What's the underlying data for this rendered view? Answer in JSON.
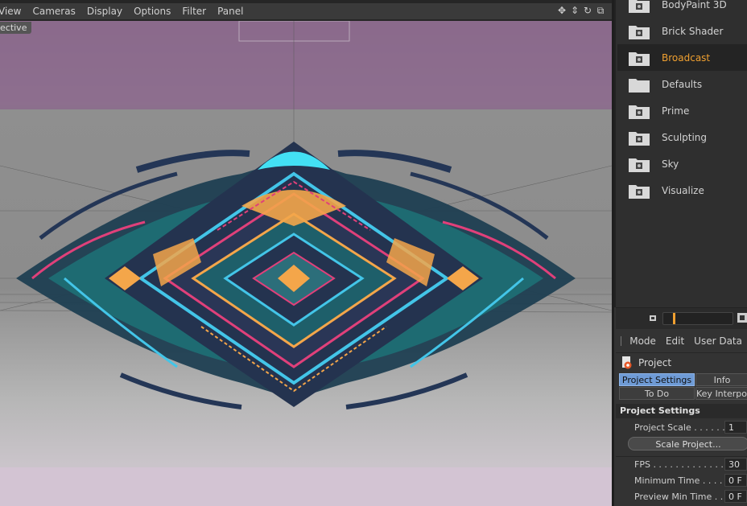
{
  "menubar": {
    "items": [
      "View",
      "Cameras",
      "Display",
      "Options",
      "Filter",
      "Panel"
    ]
  },
  "viewport": {
    "camera_label": "ective"
  },
  "presets": {
    "items": [
      {
        "label": "BodyPaint 3D",
        "locked": true
      },
      {
        "label": "Brick Shader",
        "locked": true
      },
      {
        "label": "Broadcast",
        "locked": true,
        "active": true
      },
      {
        "label": "Defaults",
        "locked": false
      },
      {
        "label": "Prime",
        "locked": true
      },
      {
        "label": "Sculpting",
        "locked": true
      },
      {
        "label": "Sky",
        "locked": true
      },
      {
        "label": "Visualize",
        "locked": true
      }
    ],
    "zoom_fraction": 0.14,
    "active_color": "#f0a030"
  },
  "attributes": {
    "menu": [
      "Mode",
      "Edit",
      "User Data"
    ],
    "object_name": "Project",
    "tabs": {
      "project_settings": "Project Settings",
      "info": "Info",
      "todo": "To Do",
      "key_interp": "Key Interpol"
    },
    "group_title": "Project Settings",
    "fields": {
      "project_scale_label": "Project Scale . . . . . .",
      "project_scale_value": "1",
      "scale_button": "Scale Project...",
      "fps_label": "FPS . . . . . . . . . . . . . . .",
      "fps_value": "30",
      "min_time_label": "Minimum Time . . . . . .",
      "min_time_value": "0 F",
      "preview_min_label": "Preview Min Time . .",
      "preview_min_value": "0 F"
    }
  }
}
